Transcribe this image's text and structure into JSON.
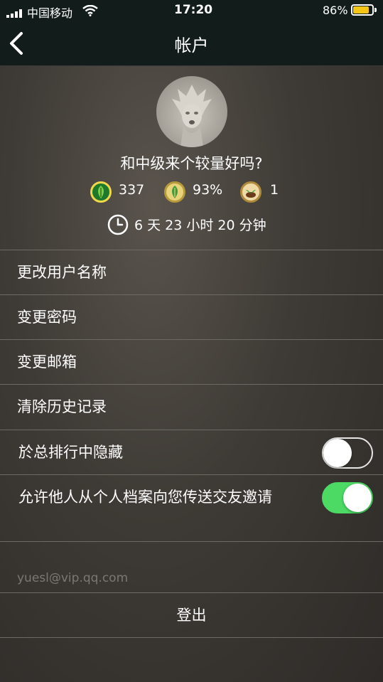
{
  "status_bar": {
    "carrier": "中国移动",
    "time": "17:20",
    "battery": "86%",
    "battery_level": 0.86
  },
  "nav": {
    "title": "帐户",
    "back_icon": "chevron-left-icon"
  },
  "profile": {
    "username": "和中级来个较量好吗?",
    "stats": [
      {
        "icon": "leaf-coin-icon",
        "value": "337"
      },
      {
        "icon": "leaf-percent-icon",
        "value": "93%"
      },
      {
        "icon": "sprout-icon",
        "value": "1"
      }
    ],
    "timer_icon": "clock-icon",
    "timer": "6 天 23 小时 20 分钟"
  },
  "menu": {
    "change_username": "更改用户名称",
    "change_password": "变更密码",
    "change_email": "变更邮箱",
    "clear_history": "清除历史记录",
    "hide_leaderboard": "於总排行中隐藏",
    "hide_leaderboard_on": false,
    "allow_friend_requests": "允许他人从个人档案向您传送交友邀请",
    "allow_friend_requests_on": true
  },
  "account": {
    "email": "yuesl@vip.qq.com",
    "logout": "登出"
  },
  "colors": {
    "toggle_on": "#4cd964",
    "battery": "#f5c518",
    "nav_bg": "#121c1b"
  }
}
